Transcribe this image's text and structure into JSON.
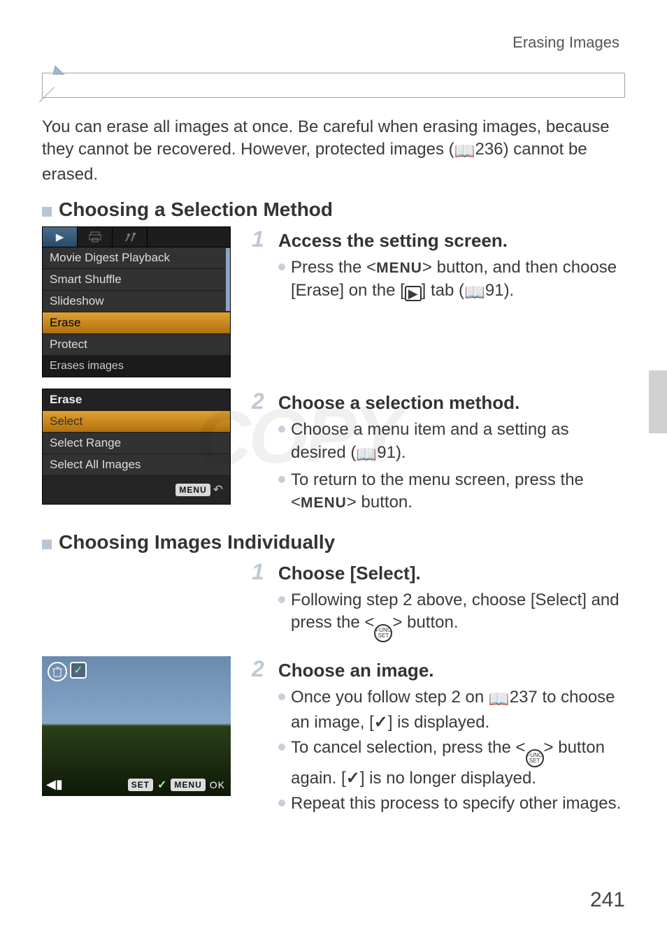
{
  "header": {
    "section_title": "Erasing Images"
  },
  "intro": {
    "text_before_ref": "You can erase all images at once. Be careful when erasing images, because they cannot be recovered. However, protected images (",
    "ref": "236",
    "text_after_ref": ") cannot be erased."
  },
  "sections": {
    "sel_method": {
      "title": "Choosing a Selection Method",
      "step1": {
        "num": "1",
        "title": "Access the setting screen.",
        "b1_a": "Press the <",
        "b1_menu": "MENU",
        "b1_b": "> button, and then choose [Erase] on the [",
        "b1_c": "] tab (",
        "b1_ref": "91",
        "b1_d": ")."
      },
      "step2": {
        "num": "2",
        "title": "Choose a selection method.",
        "b1_a": "Choose a menu item and a setting as desired (",
        "b1_ref": "91",
        "b1_b": ").",
        "b2_a": "To return to the menu screen, press the <",
        "b2_menu": "MENU",
        "b2_b": "> button."
      }
    },
    "indiv": {
      "title": "Choosing Images Individually",
      "step1": {
        "num": "1",
        "title": "Choose [Select].",
        "b1_a": "Following step 2 above, choose [Select] and press the <",
        "b1_b": "> button."
      },
      "step2": {
        "num": "2",
        "title": "Choose an image.",
        "b1_a": "Once you follow step 2 on ",
        "b1_ref": "237",
        "b1_b": " to choose an image, [",
        "b1_c": "] is displayed.",
        "b2_a": "To cancel selection, press the <",
        "b2_b": "> button again. [",
        "b2_c": "] is no longer displayed.",
        "b3": "Repeat this process to specify other images."
      }
    }
  },
  "cam_menu1": {
    "tabs": [
      "▶",
      "print",
      "tools"
    ],
    "items": [
      "Movie Digest Playback",
      "Smart Shuffle",
      "Slideshow",
      "Erase",
      "Protect"
    ],
    "selected_index": 3,
    "status": "Erases images"
  },
  "cam_menu2": {
    "title": "Erase",
    "items": [
      "Select",
      "Select Range",
      "Select All Images"
    ],
    "selected_index": 0,
    "footer": "MENU"
  },
  "photo": {
    "trash_icon": "trash-icon",
    "check_icon": "check-icon",
    "bottom_left": "◀▮",
    "set_label": "SET",
    "menu_label": "MENU",
    "ok_label": "OK"
  },
  "icons": {
    "book": "📖",
    "play_tab": "▶",
    "check": "✓",
    "func_top": "FUNC",
    "func_bot": "SET",
    "back_arrow": "↶"
  },
  "watermark": "COPY",
  "page_number": "241"
}
